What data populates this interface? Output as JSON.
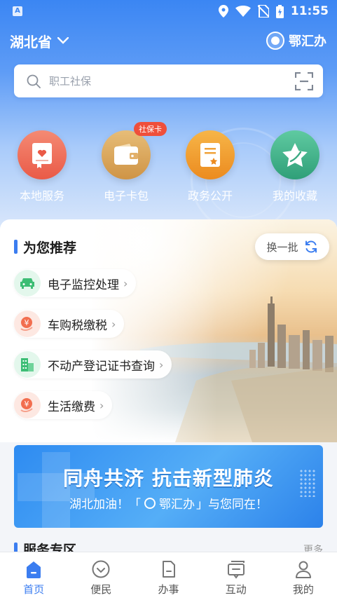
{
  "status_bar": {
    "app_indicator": "A",
    "time": "11:55"
  },
  "header": {
    "province": "湖北省",
    "brand": "鄂汇办"
  },
  "search": {
    "placeholder": "职工社保"
  },
  "quick_services": [
    {
      "label": "本地服务",
      "icon": "bookmark-heart-icon",
      "color": "#f06a55"
    },
    {
      "label": "电子卡包",
      "icon": "wallet-icon",
      "color": "#d9a457",
      "badge": "社保卡"
    },
    {
      "label": "政务公开",
      "icon": "document-star-icon",
      "color": "#f09a2e"
    },
    {
      "label": "我的收藏",
      "icon": "star-icon",
      "color": "#43b38d"
    }
  ],
  "recommend": {
    "title": "为您推荐",
    "refresh_label": "换一批",
    "items": [
      {
        "label": "电子监控处理",
        "icon": "car-icon"
      },
      {
        "label": "车购税缴税",
        "icon": "yuan-coin-icon"
      },
      {
        "label": "不动产登记证书查询",
        "icon": "building-icon"
      },
      {
        "label": "生活缴费",
        "icon": "yuan-coin-icon"
      }
    ]
  },
  "banner": {
    "title": "同舟共济 抗击新型肺炎",
    "sub_prefix": "湖北加油！「",
    "sub_brand": "鄂汇办",
    "sub_suffix": "」与您同在！"
  },
  "service_zone": {
    "title": "服务专区",
    "more": "更多"
  },
  "tabbar": [
    {
      "label": "首页",
      "icon": "home-icon",
      "active": true
    },
    {
      "label": "便民",
      "icon": "heart-circle-icon",
      "active": false
    },
    {
      "label": "办事",
      "icon": "file-icon",
      "active": false
    },
    {
      "label": "互动",
      "icon": "chat-icon",
      "active": false
    },
    {
      "label": "我的",
      "icon": "user-icon",
      "active": false
    }
  ]
}
